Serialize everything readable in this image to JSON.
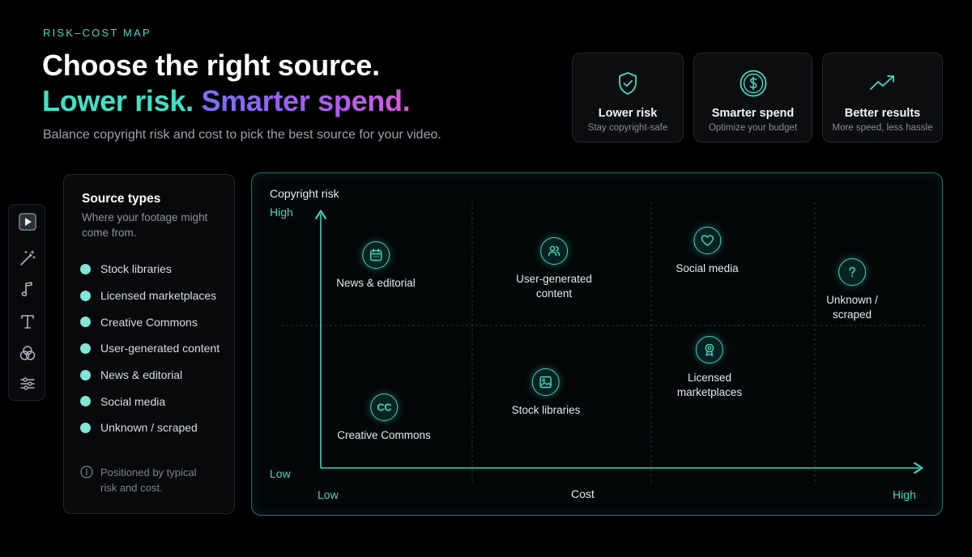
{
  "header": {
    "eyebrow": "RISK–COST MAP",
    "title": "Choose the right source.",
    "tagline_part1": "Lower risk.",
    "tagline_part2": "Smarter spend.",
    "subtitle": "Balance copyright risk and cost to pick the best source for your video."
  },
  "benefits": [
    {
      "title": "Lower risk",
      "desc": "Stay copyright-safe",
      "icon": "shield-check-icon"
    },
    {
      "title": "Smarter spend",
      "desc": "Optimize your budget",
      "icon": "dollar-coin-icon"
    },
    {
      "title": "Better results",
      "desc": "More speed, less hassle",
      "icon": "trend-up-icon"
    }
  ],
  "toolbar": [
    "play-icon",
    "magic-wand-icon",
    "music-note-icon",
    "text-icon",
    "color-circles-icon",
    "sliders-icon"
  ],
  "sources_panel": {
    "title": "Source types",
    "description": "Where your footage might come from.",
    "items": [
      "Stock libraries",
      "Licensed marketplaces",
      "Creative Commons",
      "User-generated content",
      "News & editorial",
      "Social media",
      "Unknown / scraped"
    ],
    "note": "Positioned by typical risk and cost."
  },
  "map": {
    "y_axis_title": "Copyright risk",
    "y_high": "High",
    "y_low": "Low",
    "x_axis_title": "Cost",
    "x_low": "Low",
    "x_high": "High",
    "nodes": [
      {
        "label": "News & editorial",
        "icon": "calendar-icon"
      },
      {
        "label": "User-generated\ncontent",
        "icon": "users-icon"
      },
      {
        "label": "Social media",
        "icon": "heart-icon"
      },
      {
        "label": "Unknown /\nscraped",
        "icon": "question-icon"
      },
      {
        "label": "Licensed\nmarketplaces",
        "icon": "badge-icon"
      },
      {
        "label": "Stock libraries",
        "icon": "image-icon"
      },
      {
        "label": "Creative Commons",
        "icon": "cc-icon"
      }
    ]
  },
  "colors": {
    "accent": "#45d9c4",
    "gradient_start": "#7a6cff",
    "gradient_end": "#d35bd8"
  }
}
